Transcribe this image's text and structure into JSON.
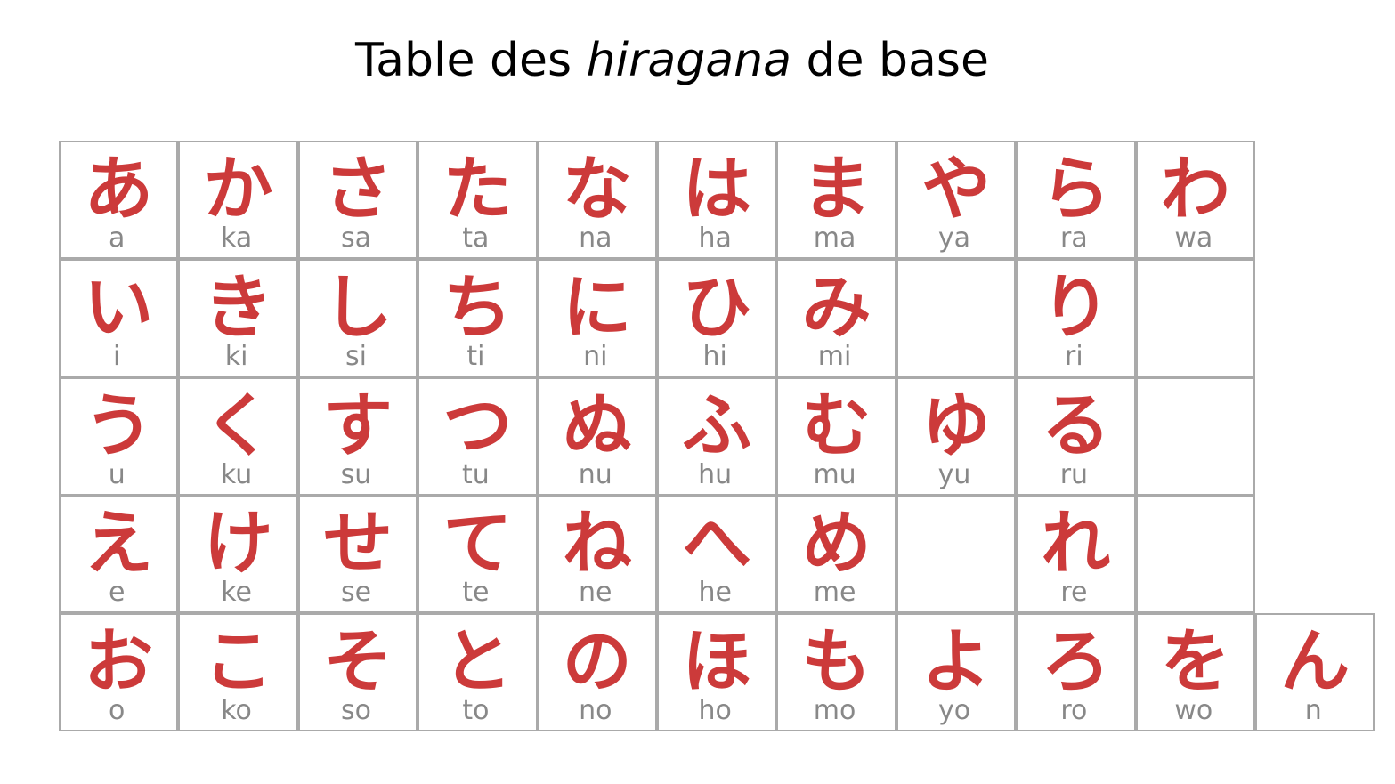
{
  "title": {
    "before": "Table des ",
    "italic": "hiragana",
    "after": " de base"
  },
  "colors": {
    "kana": "#cc3a3a",
    "romaji": "#888888",
    "border": "#aaaaaa"
  },
  "rows": [
    [
      [
        "あ",
        "a"
      ],
      [
        "か",
        "ka"
      ],
      [
        "さ",
        "sa"
      ],
      [
        "た",
        "ta"
      ],
      [
        "な",
        "na"
      ],
      [
        "は",
        "ha"
      ],
      [
        "ま",
        "ma"
      ],
      [
        "や",
        "ya"
      ],
      [
        "ら",
        "ra"
      ],
      [
        "わ",
        "wa"
      ]
    ],
    [
      [
        "い",
        "i"
      ],
      [
        "き",
        "ki"
      ],
      [
        "し",
        "si"
      ],
      [
        "ち",
        "ti"
      ],
      [
        "に",
        "ni"
      ],
      [
        "ひ",
        "hi"
      ],
      [
        "み",
        "mi"
      ],
      null,
      [
        "り",
        "ri"
      ],
      null
    ],
    [
      [
        "う",
        "u"
      ],
      [
        "く",
        "ku"
      ],
      [
        "す",
        "su"
      ],
      [
        "つ",
        "tu"
      ],
      [
        "ぬ",
        "nu"
      ],
      [
        "ふ",
        "hu"
      ],
      [
        "む",
        "mu"
      ],
      [
        "ゆ",
        "yu"
      ],
      [
        "る",
        "ru"
      ],
      null
    ],
    [
      [
        "え",
        "e"
      ],
      [
        "け",
        "ke"
      ],
      [
        "せ",
        "se"
      ],
      [
        "て",
        "te"
      ],
      [
        "ね",
        "ne"
      ],
      [
        "へ",
        "he"
      ],
      [
        "め",
        "me"
      ],
      null,
      [
        "れ",
        "re"
      ],
      null
    ],
    [
      [
        "お",
        "o"
      ],
      [
        "こ",
        "ko"
      ],
      [
        "そ",
        "so"
      ],
      [
        "と",
        "to"
      ],
      [
        "の",
        "no"
      ],
      [
        "ほ",
        "ho"
      ],
      [
        "も",
        "mo"
      ],
      [
        "よ",
        "yo"
      ],
      [
        "ろ",
        "ro"
      ],
      [
        "を",
        "wo"
      ],
      [
        "ん",
        "n"
      ]
    ]
  ]
}
